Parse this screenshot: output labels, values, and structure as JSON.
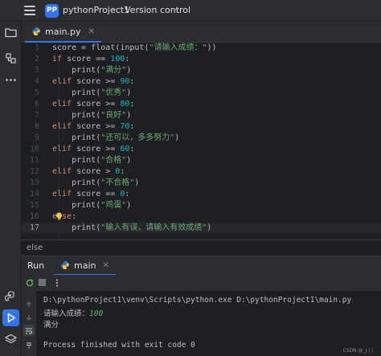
{
  "titlebar": {
    "project_badge": "PP",
    "project_name": "pythonProject1",
    "vcs_label": "Version control"
  },
  "leftbar": {
    "top_icons": [
      "folder-icon",
      "structure-icon",
      "more-icon"
    ],
    "bottom_icons": [
      "python-console-icon",
      "run-icon",
      "layers-icon",
      "terminal-icon"
    ]
  },
  "editor": {
    "tab_label": "main.py",
    "current_line": 17,
    "lines": [
      {
        "n": "1"
      },
      {
        "n": "2"
      },
      {
        "n": "3"
      },
      {
        "n": "4"
      },
      {
        "n": "5"
      },
      {
        "n": "6"
      },
      {
        "n": "7"
      },
      {
        "n": "8"
      },
      {
        "n": "9"
      },
      {
        "n": "10"
      },
      {
        "n": "11"
      },
      {
        "n": "12"
      },
      {
        "n": "13"
      },
      {
        "n": "14"
      },
      {
        "n": "15"
      },
      {
        "n": "16"
      },
      {
        "n": "17"
      }
    ],
    "code": {
      "l1_a": "score = ",
      "l1_b": "float",
      "l1_c": "(",
      "l1_d": "input",
      "l1_e": "(",
      "l1_f": "\"请输入成绩：\"",
      "l1_g": "))",
      "l2_kw": "if",
      "l2_a": " score == ",
      "l2_num": "100",
      "l2_b": ":",
      "l3_fn": "print",
      "l3_a": "(",
      "l3_str": "\"满分\"",
      "l3_b": ")",
      "l4_kw": "elif",
      "l4_a": " score >= ",
      "l4_num": "90",
      "l4_b": ":",
      "l5_fn": "print",
      "l5_a": "(",
      "l5_str": "\"优秀\"",
      "l5_b": ")",
      "l6_kw": "elif",
      "l6_a": " score >= ",
      "l6_num": "80",
      "l6_b": ":",
      "l7_fn": "print",
      "l7_a": "(",
      "l7_str": "\"良好\"",
      "l7_b": ")",
      "l8_kw": "elif",
      "l8_a": " score >= ",
      "l8_num": "70",
      "l8_b": ":",
      "l9_fn": "print",
      "l9_a": "(",
      "l9_str": "\"还可以，多多努力\"",
      "l9_b": ")",
      "l10_kw": "elif",
      "l10_a": " score >= ",
      "l10_num": "60",
      "l10_b": ":",
      "l11_fn": "print",
      "l11_a": "(",
      "l11_str": "\"合格\"",
      "l11_b": ")",
      "l12_kw": "elif",
      "l12_a": " score > ",
      "l12_num": "0",
      "l12_b": ":",
      "l13_fn": "print",
      "l13_a": "(",
      "l13_str": "\"不合格\"",
      "l13_b": ")",
      "l14_kw": "elif",
      "l14_a": " score == ",
      "l14_num": "0",
      "l14_b": ":",
      "l15_fn": "print",
      "l15_a": "(",
      "l15_str": "\"鸡蛋\"",
      "l15_b": ")",
      "l16_kw": "else",
      "l16_b": ":",
      "l17_fn": "print",
      "l17_a": "(",
      "l17_str": "\"输入有误，请输入有效成绩\"",
      "l17_b": ")"
    },
    "breadcrumb": "else"
  },
  "run_panel": {
    "title": "Run",
    "tab_label": "main",
    "console": {
      "command": "D:\\pythonProject1\\venv\\Scripts\\python.exe D:\\pythonProject1\\main.py",
      "prompt": "请输入成绩：",
      "input_value": "100",
      "output": "满分",
      "exit_msg": "Process finished with exit code 0"
    },
    "watermark": "CSDN @_J | | ."
  },
  "colors": {
    "accent": "#3574f0",
    "keyword": "#cf8e6d",
    "number": "#2aacb8",
    "string": "#6aab73",
    "background": "#1e1f22",
    "panel": "#2b2d30"
  }
}
